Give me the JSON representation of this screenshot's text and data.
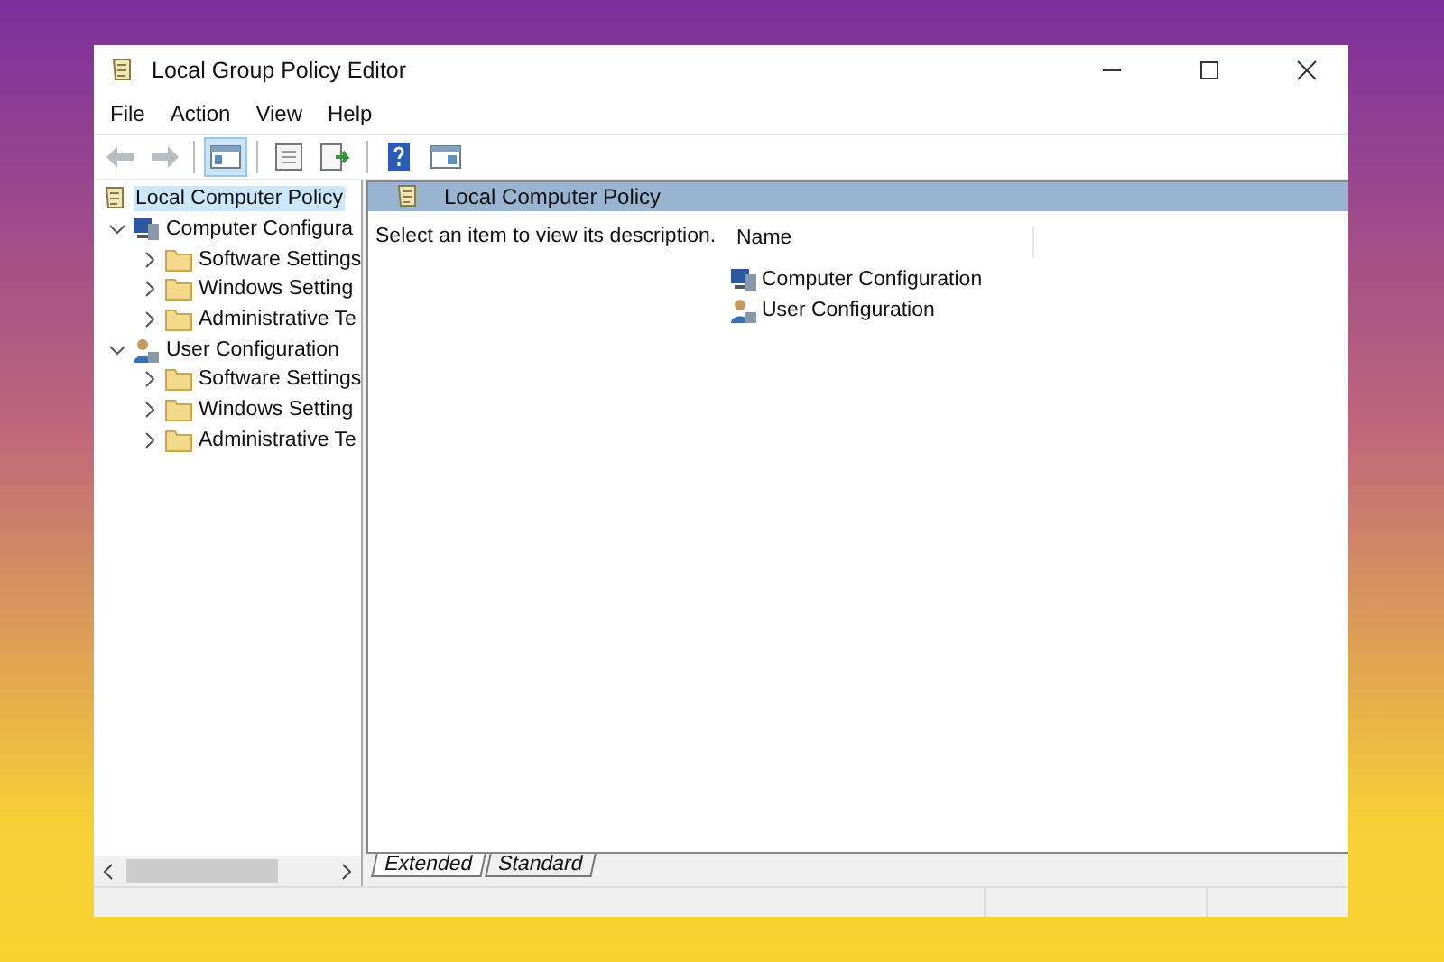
{
  "window": {
    "title": "Local Group Policy Editor"
  },
  "menu": [
    "File",
    "Action",
    "View",
    "Help"
  ],
  "toolbar": [
    {
      "kind": "back",
      "disabled": true
    },
    {
      "kind": "forward",
      "disabled": true
    },
    {
      "kind": "sep"
    },
    {
      "kind": "tree",
      "selected": true
    },
    {
      "kind": "sep"
    },
    {
      "kind": "properties",
      "selected": false
    },
    {
      "kind": "export",
      "selected": false
    },
    {
      "kind": "sep"
    },
    {
      "kind": "help",
      "selected": false
    },
    {
      "kind": "view",
      "selected": false
    }
  ],
  "tree": [
    {
      "label": "Local Computer Policy",
      "kind": "policy",
      "selected": true,
      "children": [
        {
          "label": "Computer Configura",
          "kind": "computer",
          "selected": false,
          "expanded": true,
          "children": [
            {
              "label": "Software Settings",
              "kind": "folder",
              "selected": false,
              "expanded": false
            },
            {
              "label": "Windows Setting",
              "kind": "folder",
              "selected": false,
              "expanded": false
            },
            {
              "label": "Administrative Te",
              "kind": "folder",
              "selected": false,
              "expanded": false
            }
          ]
        },
        {
          "label": "User Configuration",
          "kind": "user",
          "selected": false,
          "expanded": true,
          "children": [
            {
              "label": "Software Settings",
              "kind": "folder",
              "selected": false,
              "expanded": false
            },
            {
              "label": "Windows Setting",
              "kind": "folder",
              "selected": false,
              "expanded": false
            },
            {
              "label": "Administrative Te",
              "kind": "folder",
              "selected": false,
              "expanded": false
            }
          ]
        }
      ]
    }
  ],
  "details": {
    "header": "Local Computer Policy",
    "description": "Select an item to view its description.",
    "column": "Name",
    "items": [
      {
        "label": "Computer Configuration",
        "kind": "computer"
      },
      {
        "label": "User Configuration",
        "kind": "user"
      }
    ]
  },
  "tabs": [
    {
      "label": "Extended",
      "selected": true
    },
    {
      "label": "Standard",
      "selected": false
    }
  ]
}
